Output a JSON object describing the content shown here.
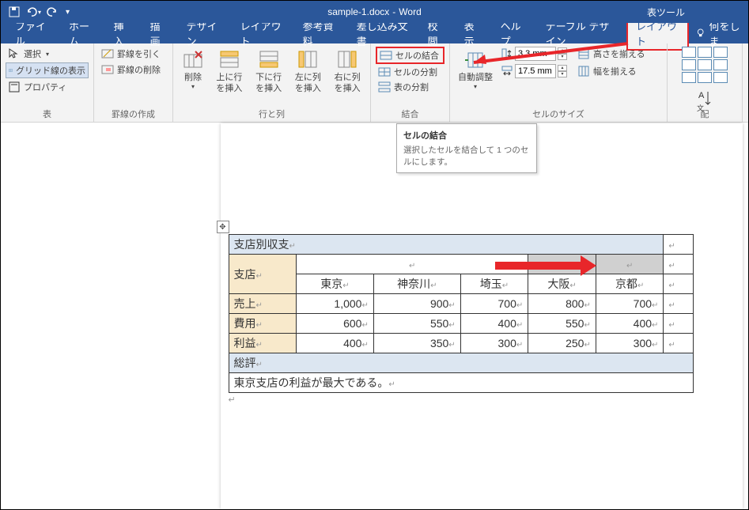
{
  "title": {
    "doc": "sample-1.docx",
    "app": "Word",
    "context": "表ツール"
  },
  "qat": {
    "save": "save-icon",
    "undo": "undo-icon",
    "redo": "redo-icon"
  },
  "menu": {
    "file": "ファイル",
    "home": "ホーム",
    "insert": "挿入",
    "draw": "描画",
    "design": "デザイン",
    "layout": "レイアウト",
    "references": "参考資料",
    "mailings": "差し込み文書",
    "review": "校閲",
    "view": "表示",
    "help": "ヘルプ",
    "tabledesign": "テーブル デザイン",
    "tablelayout": "レイアウト",
    "tellme": "何をしま"
  },
  "ribbon": {
    "table_group": "表",
    "select": "選択",
    "gridlines": "グリッド線の表示",
    "properties": "プロパティ",
    "borders_group": "罫線の作成",
    "draw_border": "罫線を引く",
    "erase_border": "罫線の削除",
    "rowcol_group": "行と列",
    "delete": "削除",
    "insert_above": "上に行を挿入",
    "insert_below": "下に行を挿入",
    "insert_left": "左に列を挿入",
    "insert_right": "右に列を挿入",
    "merge_group": "結合",
    "merge_cells": "セルの結合",
    "split_cells": "セルの分割",
    "split_table": "表の分割",
    "size_group": "セルのサイズ",
    "autofit": "自動調整",
    "height_val": "3.3 mm",
    "width_val": "17.5 mm",
    "dist_rows": "高さを揃える",
    "dist_cols": "幅を揃える",
    "align_group": "配"
  },
  "tooltip": {
    "title": "セルの結合",
    "body": "選択したセルを結合して 1 つのセルにします。"
  },
  "table": {
    "title": "支店別収支",
    "row_hdr": "支店",
    "cols": [
      "東京",
      "神奈川",
      "埼玉",
      "大阪",
      "京都"
    ],
    "rows": [
      {
        "label": "売上",
        "v": [
          "1,000",
          "900",
          "700",
          "800",
          "700"
        ]
      },
      {
        "label": "費用",
        "v": [
          "600",
          "550",
          "400",
          "550",
          "400"
        ]
      },
      {
        "label": "利益",
        "v": [
          "400",
          "350",
          "300",
          "250",
          "300"
        ]
      }
    ],
    "summary_hdr": "総評",
    "summary": "東京支店の利益が最大である。"
  }
}
